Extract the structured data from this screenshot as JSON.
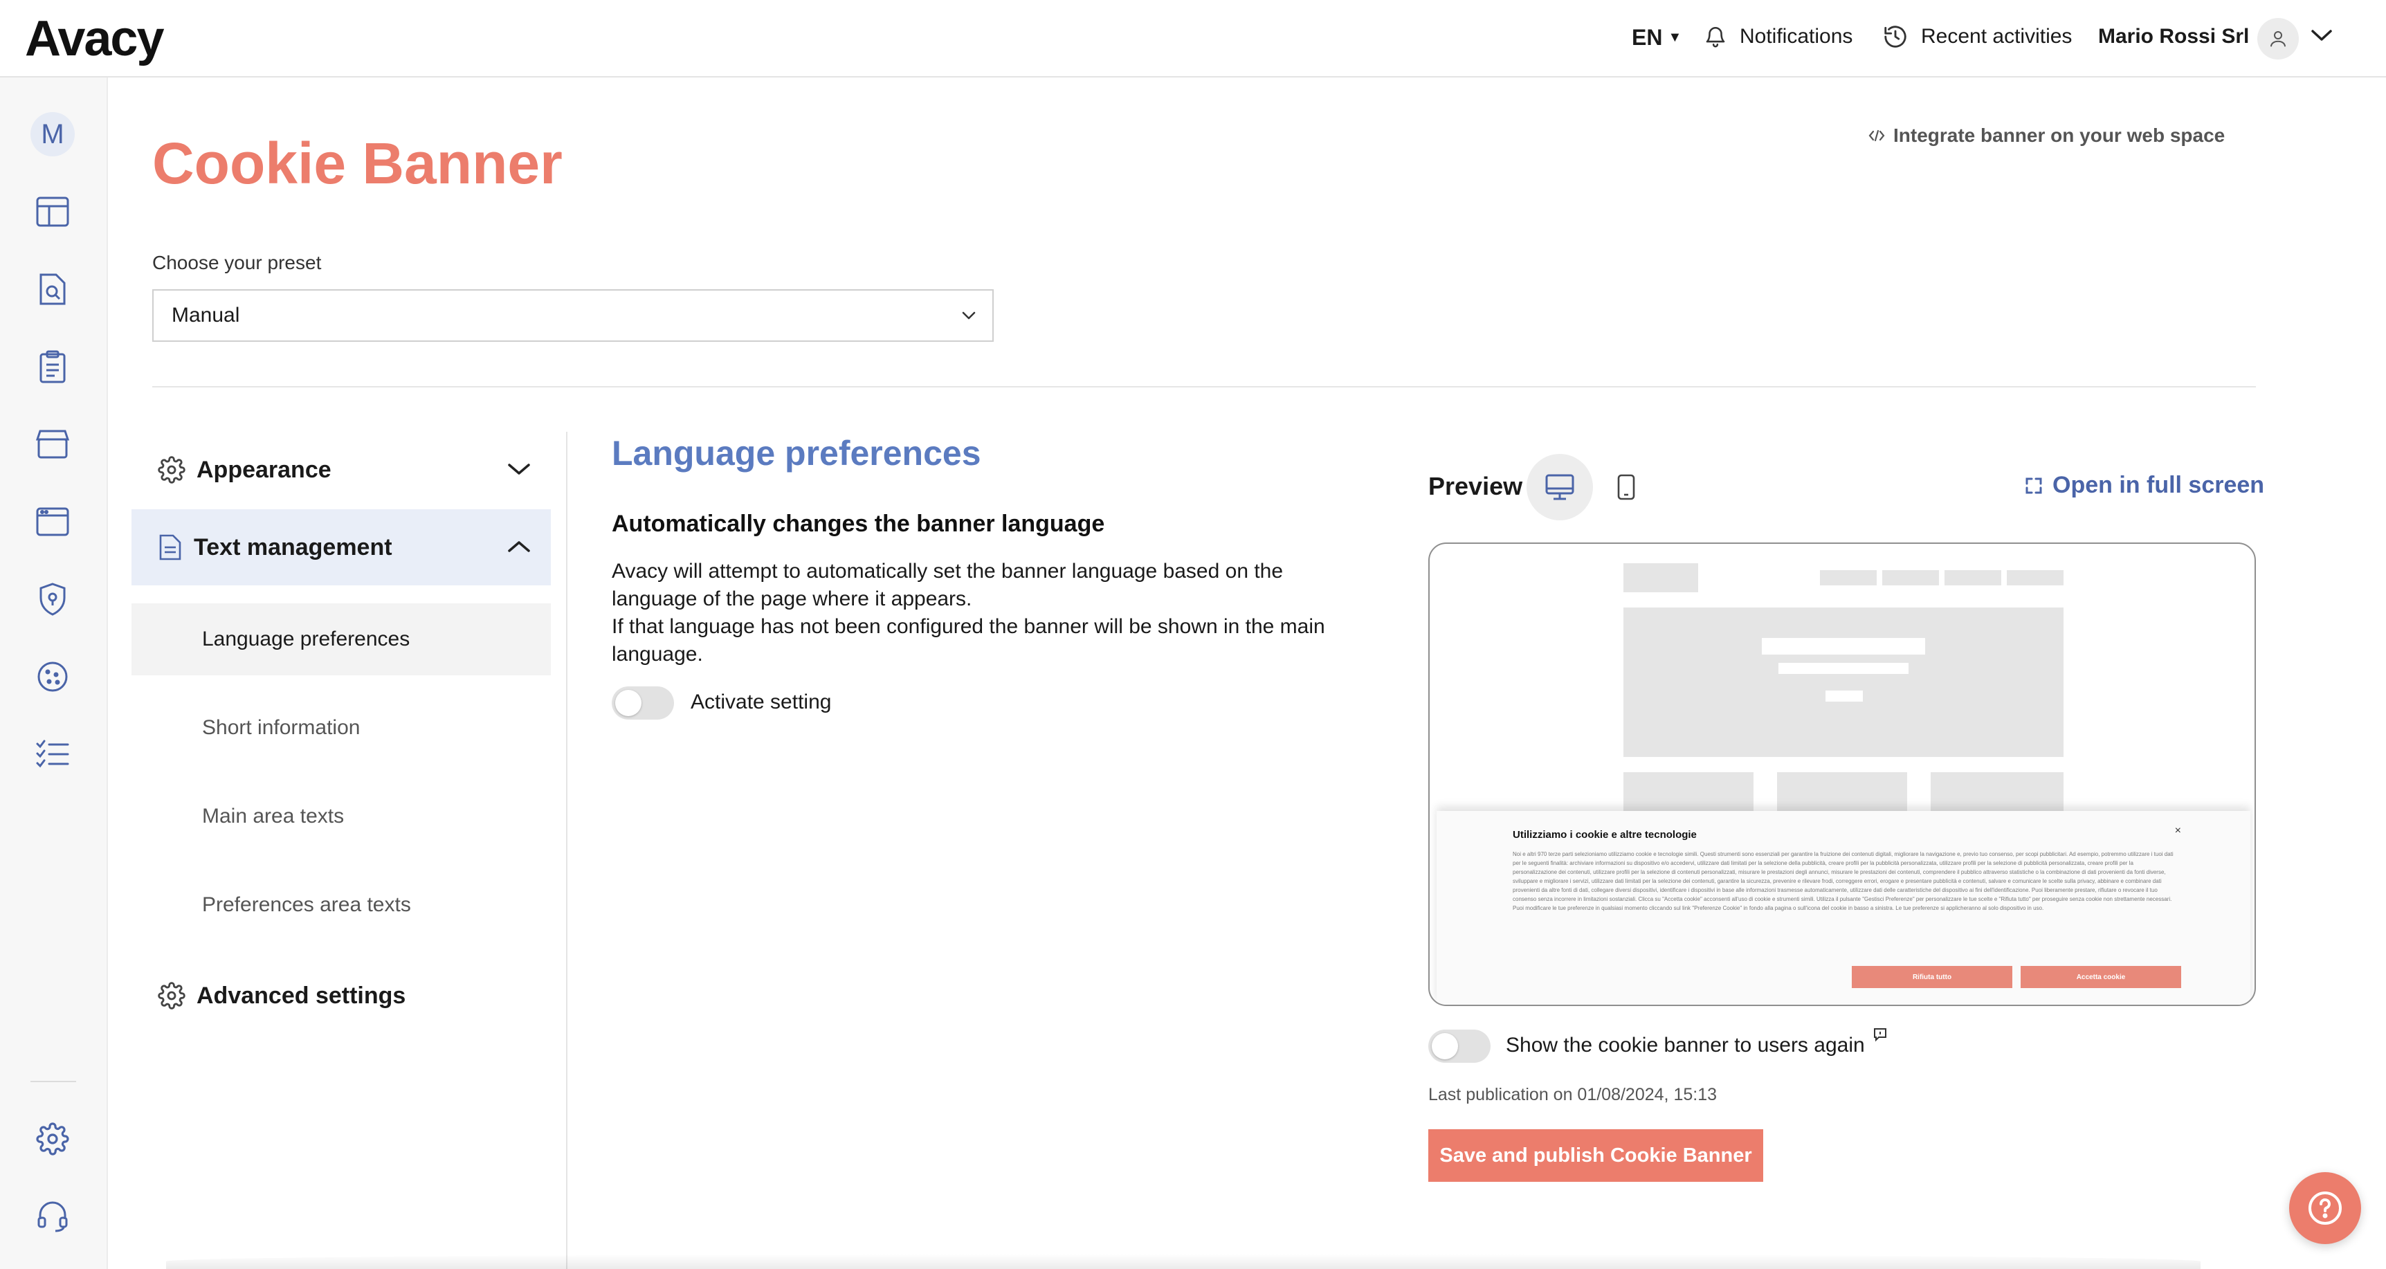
{
  "brand": {
    "logo_text": "Avacy",
    "accent_color": "#ec7d6c",
    "link_color": "#4a64a8"
  },
  "topbar": {
    "language": "EN",
    "notifications_label": "Notifications",
    "recent_label": "Recent activities",
    "account_name": "Mario Rossi Srl"
  },
  "sidebar": {
    "avatar_letter": "M",
    "icons": [
      "layout-icon",
      "document-search-icon",
      "clipboard-icon",
      "store-icon",
      "browser-window-icon",
      "shield-icon",
      "cookie-icon",
      "checklist-icon",
      "gear-icon",
      "headset-icon"
    ]
  },
  "page": {
    "title": "Cookie Banner",
    "integrate_label": "Integrate banner on your web space",
    "preset_label": "Choose your preset",
    "preset_value": "Manual"
  },
  "nav": {
    "appearance": "Appearance",
    "text_management": "Text management",
    "items": [
      "Language preferences",
      "Short information",
      "Main area texts",
      "Preferences area texts"
    ],
    "advanced": "Advanced settings"
  },
  "content": {
    "title": "Language preferences",
    "heading": "Automatically changes the banner language",
    "description": "Avacy will attempt to automatically set the banner language based on the language of the page where it appears.\nIf that language has not been configured the banner will be shown in the main language.",
    "toggle_label": "Activate setting",
    "toggle_on": false
  },
  "preview": {
    "label": "Preview",
    "fullscreen_label": "Open in full screen",
    "banner_title": "Utilizziamo i cookie e altre tecnologie",
    "banner_text": "Noi e altri 970 terze parti selezioniamo utilizziamo cookie e tecnologie simili. Questi strumenti sono essenziali per garantire la fruizione dei contenuti digitali, migliorare la navigazione e, previo tuo consenso, per scopi pubblicitari. Ad esempio, potremmo utilizzare i tuoi dati per le seguenti finalità: archiviare informazioni su dispositivo e/o accedervi, utilizzare dati limitati per la selezione della pubblicità, creare profili per la pubblicità personalizzata, utilizzare profili per la selezione di pubblicità personalizzata, creare profili per la personalizzazione dei contenuti, utilizzare profili per la selezione di contenuti personalizzati, misurare le prestazioni degli annunci, misurare le prestazioni dei contenuti, comprendere il pubblico attraverso statistiche o la combinazione di dati provenienti da fonti diverse, sviluppare e migliorare i servizi, utilizzare dati limitati per la selezione dei contenuti, garantire la sicurezza, prevenire e rilevare frodi, correggere errori, erogare e presentare pubblicità e contenuti, salvare e comunicare le scelte sulla privacy, abbinare e combinare dati provenienti da altre fonti di dati, collegare diversi dispositivi, identificare i dispositivi in base alle informazioni trasmesse automaticamente, utilizzare dati delle caratteristiche del dispositivo ai fini dell'identificazione. Puoi liberamente prestare, rifiutare o revocare il tuo consenso senza incorrere in limitazioni sostanziali. Clicca su \"Accetta cookie\" acconsenti all'uso di cookie e strumenti simili. Utilizza il pulsante \"Gestisci Preferenze\" per personalizzare le tue scelte e \"Rifiuta tutto\" per proseguire senza cookie non strettamente necessari. Puoi modificare le tue preferenze in qualsiasi momento cliccando sul link \"Preferenze Cookie\" in fondo alla pagina o sull'icona del cookie in basso a sinistra. Le tue preferenze si applicheranno al solo dispositivo in uso.",
    "reject_label": "Rifiuta tutto",
    "accept_label": "Accetta cookie",
    "show_again_label": "Show the cookie banner to users again",
    "show_again_on": false,
    "last_publication": "Last publication on 01/08/2024, 15:13",
    "save_label": "Save and publish Cookie Banner"
  }
}
